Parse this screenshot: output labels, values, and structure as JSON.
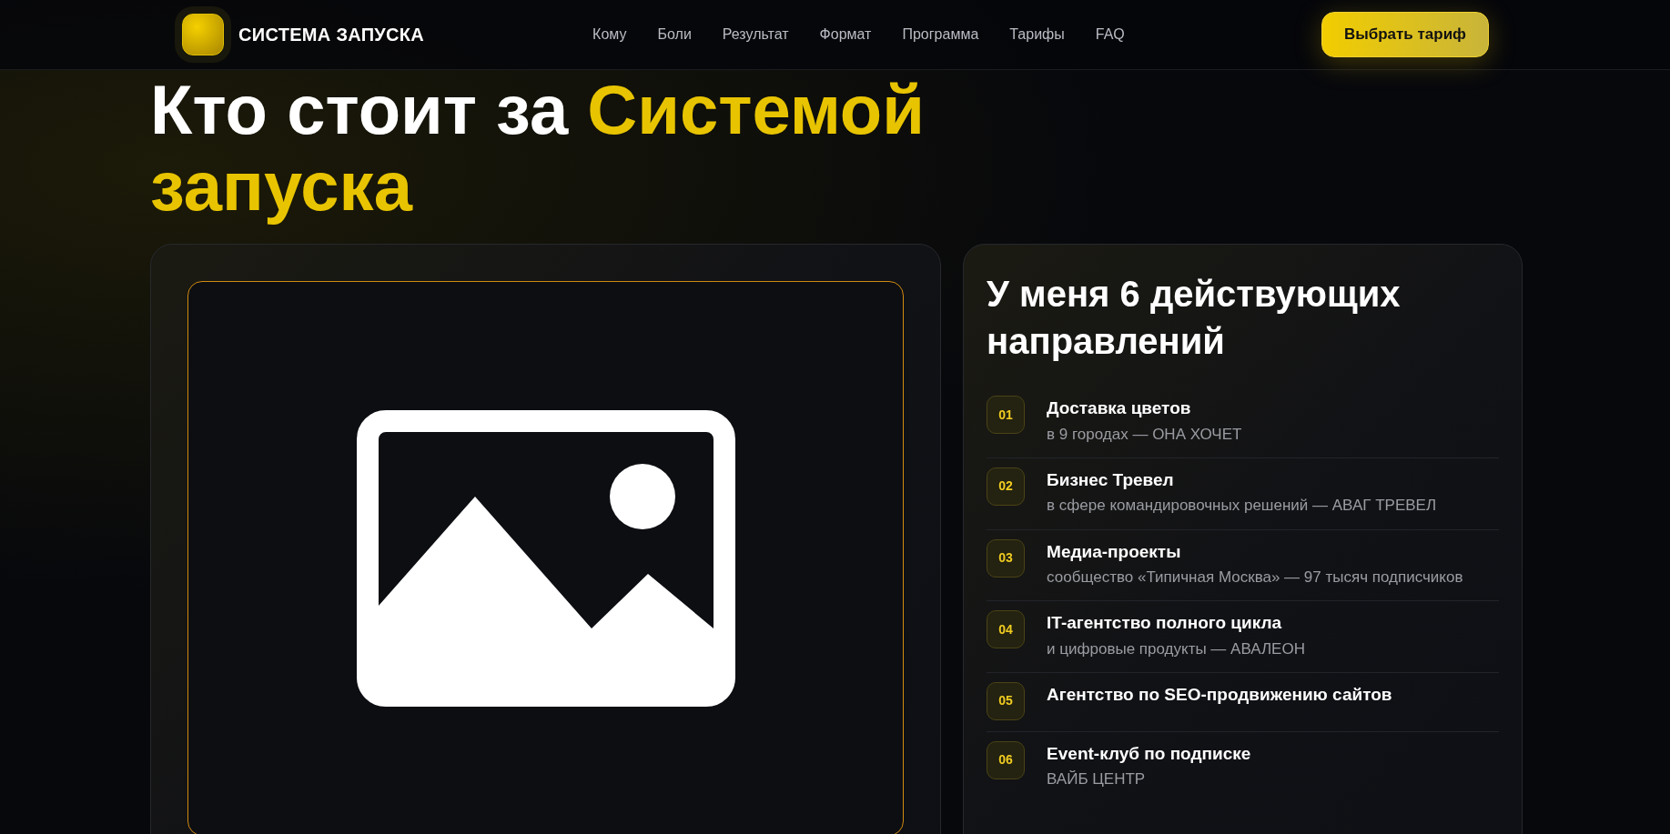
{
  "navbar": {
    "brand": "СИСТЕМА ЗАПУСКА",
    "links": [
      {
        "label": "Кому"
      },
      {
        "label": "Боли"
      },
      {
        "label": "Результат"
      },
      {
        "label": "Формат"
      },
      {
        "label": "Программа"
      },
      {
        "label": "Тарифы"
      },
      {
        "label": "FAQ"
      }
    ],
    "cta": "Выбрать тариф"
  },
  "hero": {
    "title_plain": "Кто стоит за ",
    "title_accent": "Системой запуска"
  },
  "directions": {
    "title": "У меня 6 действующих направлений",
    "items": [
      {
        "number": "01",
        "title": "Доставка цветов",
        "subtitle": "в 9 городах — ОНА ХОЧЕТ"
      },
      {
        "number": "02",
        "title": "Бизнес Тревел",
        "subtitle": "в сфере командировочных решений — АВАГ ТРЕВЕЛ"
      },
      {
        "number": "03",
        "title": "Медиа-проекты",
        "subtitle": "сообщество «Типичная Москва» — 97 тысяч подписчиков"
      },
      {
        "number": "04",
        "title": "IT-агентство полного цикла",
        "subtitle": "и цифровые продукты — АВАЛЕОН"
      },
      {
        "number": "05",
        "title": "Агентство по SEO-продвижению сайтов"
      },
      {
        "number": "06",
        "title": "Event-клуб по подписке",
        "subtitle": "ВАЙБ ЦЕНТР"
      }
    ]
  }
}
